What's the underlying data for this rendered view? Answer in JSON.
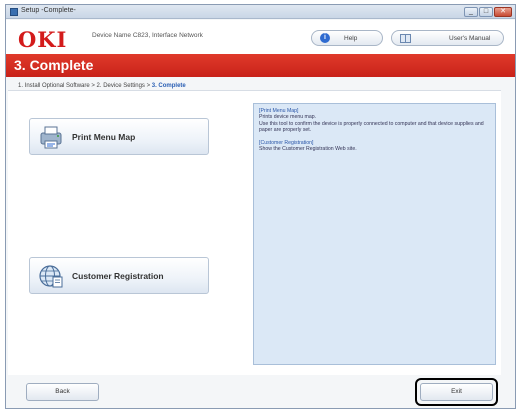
{
  "window": {
    "title": "Setup -Complete-"
  },
  "window_controls": [
    "_",
    "□",
    "✕"
  ],
  "header": {
    "logo": "OKI",
    "device_name": "Device Name C823, Interface Network",
    "help_label": "Help",
    "manual_label": "User's Manual"
  },
  "step_title": "3. Complete",
  "breadcrumb": {
    "prefix": "1. Install Optional Software > 2. Device Settings > ",
    "current": "3. Complete"
  },
  "buttons": {
    "print_menu_map": "Print Menu Map",
    "customer_registration": "Customer Registration",
    "back": "Back",
    "exit": "Exit"
  },
  "description": {
    "print_head": "[Print Menu Map]",
    "print_line1": "Prints device menu map.",
    "print_line2": "Use this tool to confirm the device is properly connected to computer and that device supplies and paper are properly set.",
    "reg_head": "[Customer Registration]",
    "reg_line1": "Show the Customer Registration Web site."
  },
  "colors": {
    "brand_red": "#d31b1b",
    "step_bar": "#d0281c",
    "desc_panel": "#dbe8f6",
    "link_blue": "#2a5fb4"
  },
  "icons": [
    "app-icon",
    "help-icon",
    "manual-book-icon",
    "print-menu-icon",
    "globe-registration-icon"
  ]
}
